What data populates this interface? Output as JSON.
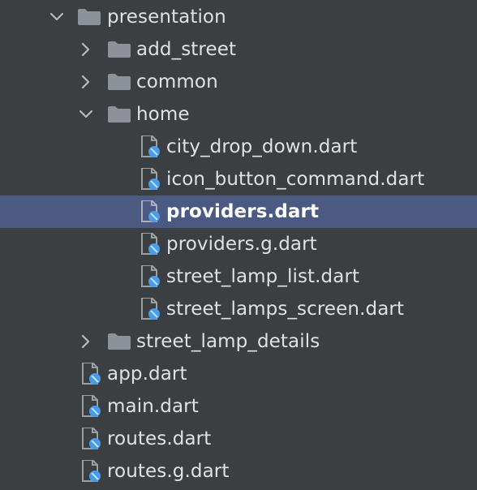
{
  "tree": {
    "items": [
      {
        "label": "presentation",
        "kind": "folder",
        "state": "expanded",
        "icon": "folder-icon"
      },
      {
        "label": "add_street",
        "kind": "folder",
        "state": "collapsed",
        "icon": "folder-icon"
      },
      {
        "label": "common",
        "kind": "folder",
        "state": "collapsed",
        "icon": "folder-icon"
      },
      {
        "label": "home",
        "kind": "folder",
        "state": "expanded",
        "icon": "folder-icon"
      },
      {
        "label": "city_drop_down.dart",
        "kind": "file",
        "icon": "dart-file-icon"
      },
      {
        "label": "icon_button_command.dart",
        "kind": "file",
        "icon": "dart-file-icon"
      },
      {
        "label": "providers.dart",
        "kind": "file",
        "icon": "dart-file-icon",
        "selected": true
      },
      {
        "label": "providers.g.dart",
        "kind": "file",
        "icon": "dart-file-icon"
      },
      {
        "label": "street_lamp_list.dart",
        "kind": "file",
        "icon": "dart-file-icon"
      },
      {
        "label": "street_lamps_screen.dart",
        "kind": "file",
        "icon": "dart-file-icon"
      },
      {
        "label": "street_lamp_details",
        "kind": "folder",
        "state": "collapsed",
        "icon": "folder-icon"
      },
      {
        "label": "app.dart",
        "kind": "file",
        "icon": "dart-file-icon"
      },
      {
        "label": "main.dart",
        "kind": "file",
        "icon": "dart-file-icon"
      },
      {
        "label": "routes.dart",
        "kind": "file",
        "icon": "dart-file-icon"
      },
      {
        "label": "routes.g.dart",
        "kind": "file",
        "icon": "dart-file-icon"
      }
    ]
  },
  "colors": {
    "background": "#3c3f41",
    "selection": "#4b5a83",
    "text": "#dfe1e5",
    "folder": "#8d9199",
    "dart_blue": "#4a9be8"
  }
}
